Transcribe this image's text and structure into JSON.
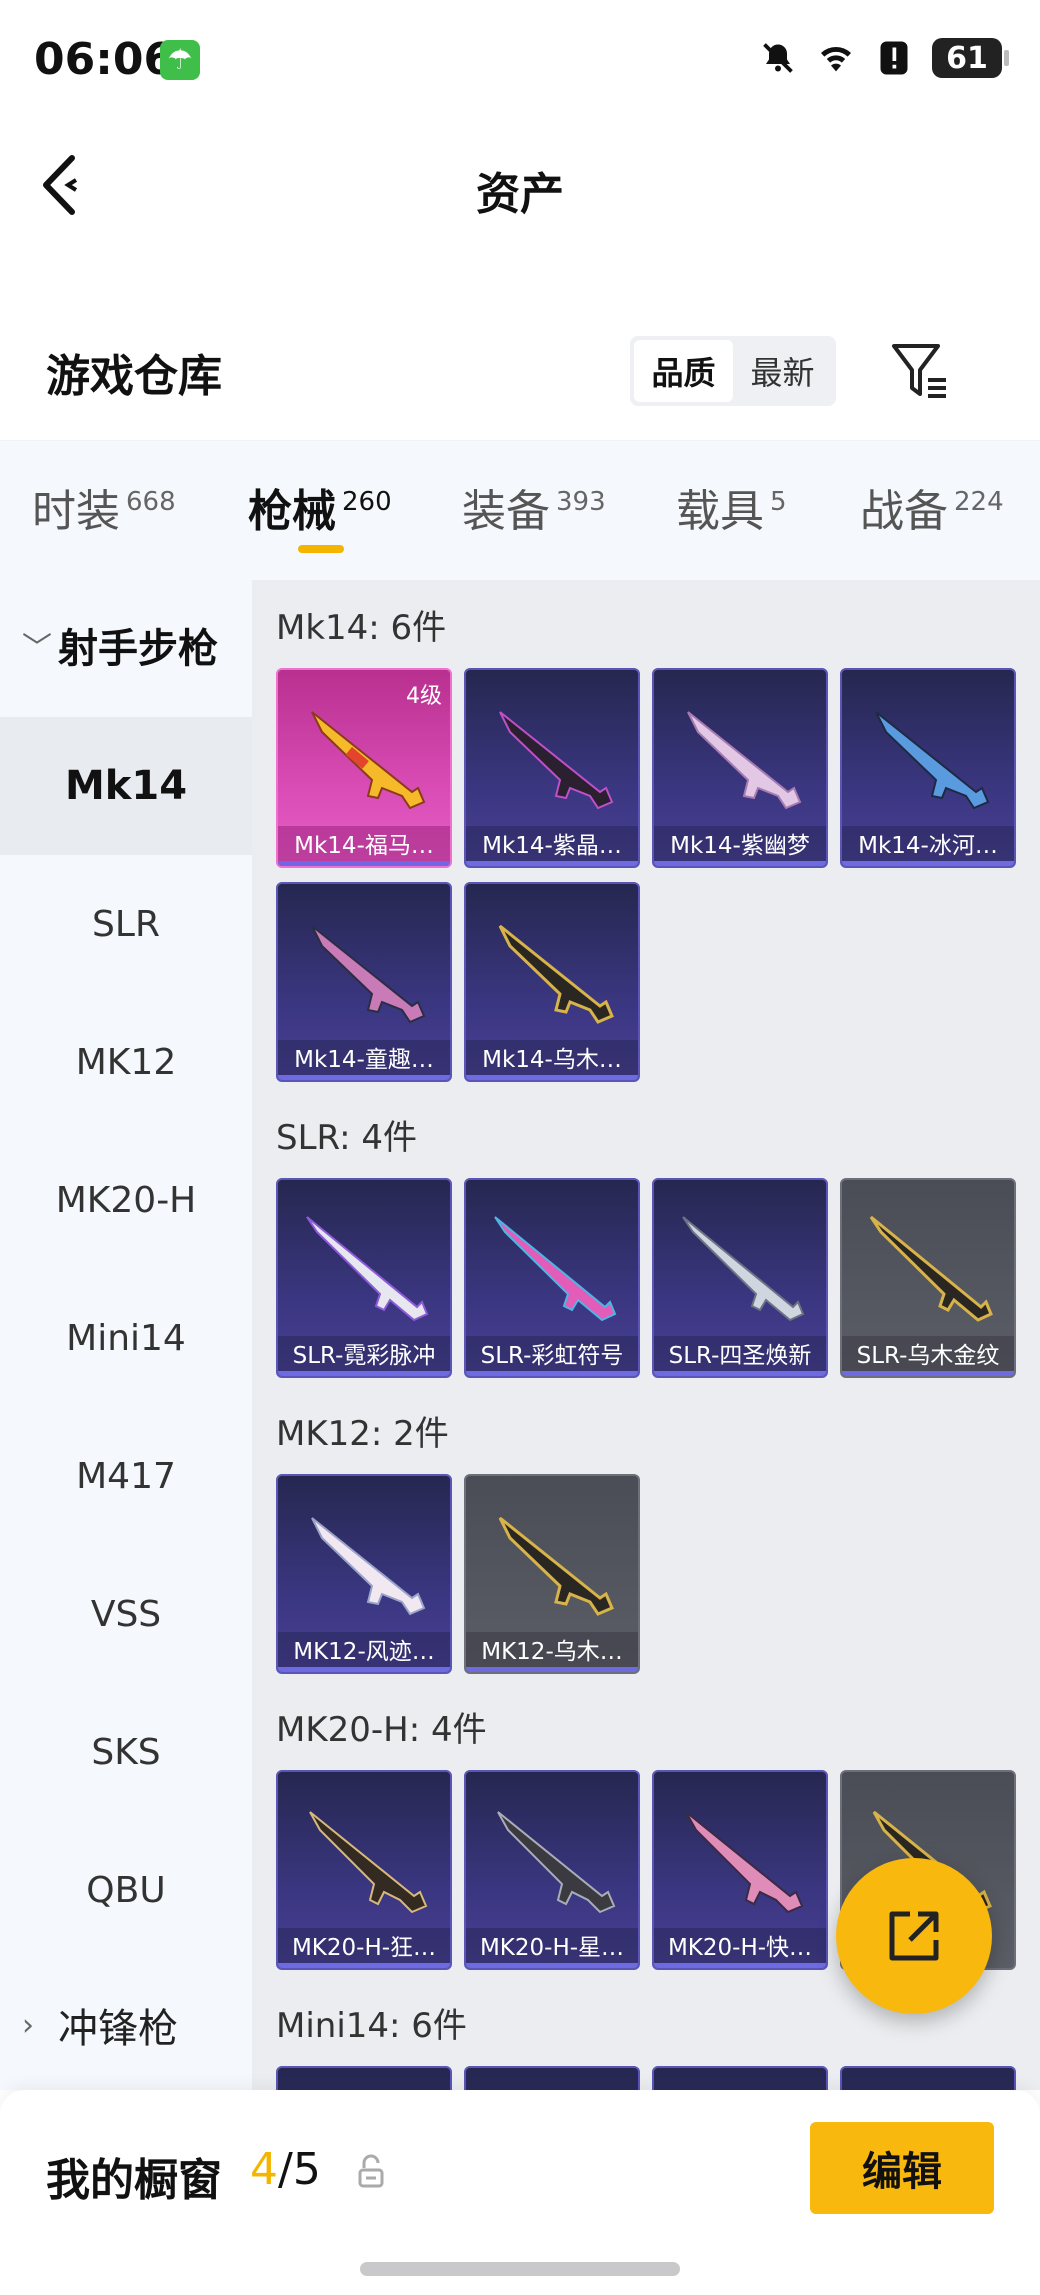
{
  "status_bar": {
    "time": "06:06",
    "battery": "61"
  },
  "header": {
    "title": "资产"
  },
  "section": {
    "title": "游戏仓库",
    "sort_options": [
      "品质",
      "最新"
    ]
  },
  "tabs": [
    {
      "label": "时装",
      "count": "668"
    },
    {
      "label": "枪械",
      "count": "260"
    },
    {
      "label": "装备",
      "count": "393"
    },
    {
      "label": "载具",
      "count": "5"
    },
    {
      "label": "战备",
      "count": "224"
    }
  ],
  "sidebar": {
    "group1": "射手步枪",
    "items": [
      "Mk14",
      "SLR",
      "MK12",
      "MK20-H",
      "Mini14",
      "M417",
      "VSS",
      "SKS",
      "QBU"
    ],
    "group2": "冲锋枪"
  },
  "groups": [
    {
      "label": "Mk14: 6件",
      "items": [
        {
          "name": "Mk14-福马…",
          "grade": "4级"
        },
        {
          "name": "Mk14-紫晶…"
        },
        {
          "name": "Mk14-紫幽梦"
        },
        {
          "name": "Mk14-冰河…"
        },
        {
          "name": "Mk14-童趣…"
        },
        {
          "name": "Mk14-乌木…"
        }
      ]
    },
    {
      "label": "SLR: 4件",
      "items": [
        {
          "name": "SLR-霓彩脉冲"
        },
        {
          "name": "SLR-彩虹符号"
        },
        {
          "name": "SLR-四圣焕新"
        },
        {
          "name": "SLR-乌木金纹"
        }
      ]
    },
    {
      "label": "MK12: 2件",
      "items": [
        {
          "name": "MK12-风迹…"
        },
        {
          "name": "MK12-乌木…"
        }
      ]
    },
    {
      "label": "MK20-H: 4件",
      "items": [
        {
          "name": "MK20-H-狂…"
        },
        {
          "name": "MK20-H-星…"
        },
        {
          "name": "MK20-H-快…"
        }
      ]
    },
    {
      "label": "Mini14: 6件"
    }
  ],
  "bottom": {
    "showcase_label": "我的橱窗",
    "current": "4",
    "total": "/5",
    "edit_label": "编辑"
  },
  "colors": {
    "accent": "#f9b80d",
    "card_purple": "#3a3680",
    "card_pink": "#d94cb5",
    "card_grey": "#5b5e66"
  }
}
